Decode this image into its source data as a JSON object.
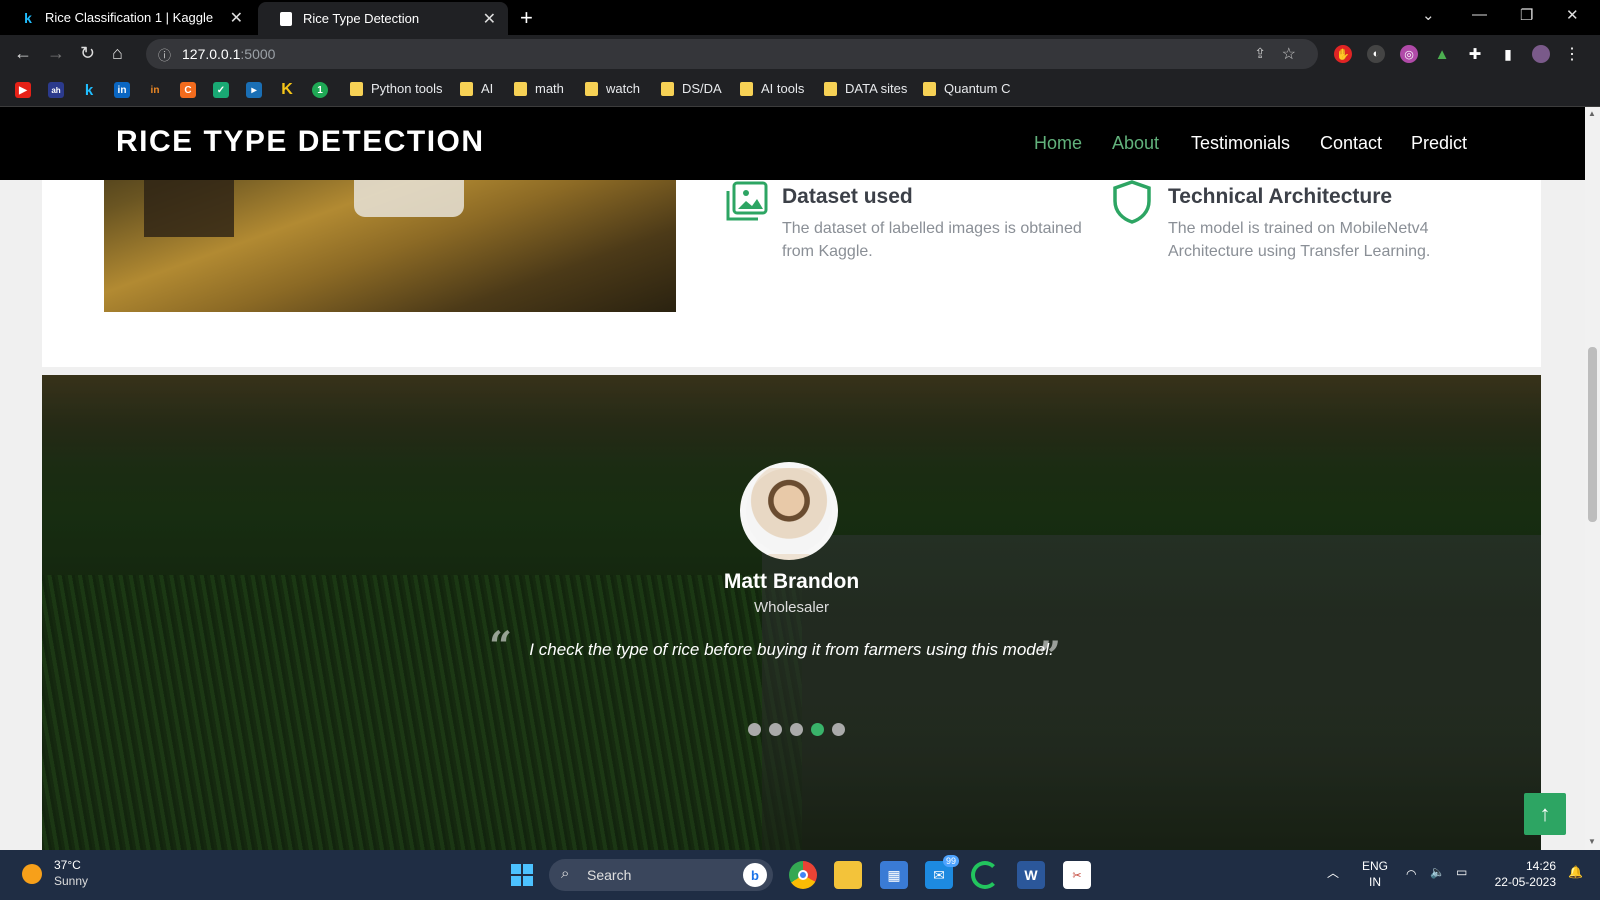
{
  "browser": {
    "tabs": [
      {
        "title": "Rice Classification 1 | Kaggle",
        "favicon": "k"
      },
      {
        "title": "Rice Type Detection",
        "favicon": "doc"
      }
    ],
    "url_host": "127.0.0.1",
    "url_port": ":5000",
    "bookmarks": [
      "Python tools",
      "AI",
      "math",
      "watch",
      "DS/DA",
      "AI tools",
      "DATA sites",
      "Quantum C"
    ]
  },
  "site": {
    "brand": "RICE TYPE DETECTION",
    "menu": [
      "Home",
      "About",
      "Testimonials",
      "Contact",
      "Predict"
    ],
    "active_menu": [
      "Home",
      "About"
    ],
    "accent_color": "#62b27c"
  },
  "features": [
    {
      "title": "Dataset used",
      "text": "The dataset of labelled images is obtained from Kaggle.",
      "icon": "images-icon"
    },
    {
      "title": "Technical Architecture",
      "text": "The model is trained on MobileNetv4 Architecture using Transfer Learning.",
      "icon": "shield-icon"
    }
  ],
  "testimonial": {
    "name": "Matt Brandon",
    "role": "Wholesaler",
    "quote": "I check the type of rice before buying it from farmers using this model.",
    "slides": 5,
    "active_slide": 4
  },
  "taskbar": {
    "weather_temp": "37°C",
    "weather_cond": "Sunny",
    "search_label": "Search",
    "mail_badge": "99",
    "lang_top": "ENG",
    "lang_bottom": "IN",
    "time": "14:26",
    "date": "22-05-2023"
  }
}
